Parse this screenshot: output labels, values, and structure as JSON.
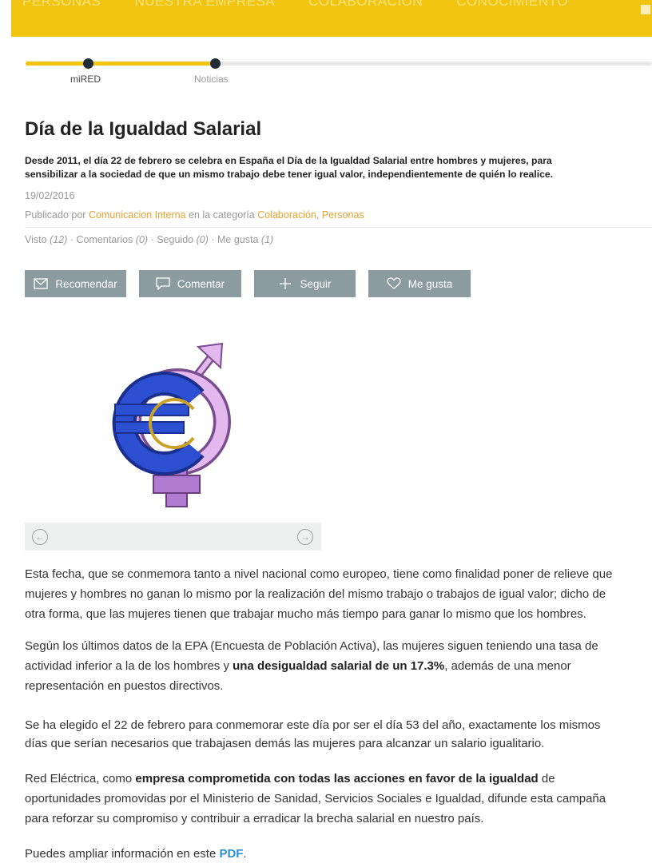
{
  "nav": {
    "items": [
      "PERSONAS",
      "NUESTRA EMPRESA",
      "COLABORACIÓN",
      "CONOCIMIENTO"
    ]
  },
  "breadcrumb_steps": [
    {
      "label": "miRED"
    },
    {
      "label": "Noticias"
    }
  ],
  "article": {
    "title": "Día de la Igualdad Salarial",
    "lead_line1": "Desde 2011, el día 22 de febrero se celebra en España el Día de la Igualdad Salarial entre hombres y mujeres, para",
    "lead_line2": "sensibilizar a la sociedad de que un mismo trabajo debe tener igual valor, independientemente de quién lo realice.",
    "date": "19/02/2016",
    "published_prefix": "Publicado por",
    "author": "Comunicacion Interna",
    "category_prefix": "en la categoría",
    "category_1": "Colaboración",
    "category_sep": ",",
    "category_2": "Personas",
    "stats": {
      "views_label": "Visto",
      "views": "(12)",
      "comments_label": "Comentarios",
      "comments": "(0)",
      "followed_label": "Seguido",
      "followed": "(0)",
      "likes_label": "Me gusta",
      "likes": "(1)",
      "separator": "·"
    },
    "buttons": {
      "recommend": "Recomendar",
      "comment": "Comentar",
      "follow": "Seguir",
      "like": "Me gusta"
    },
    "slider": {
      "prev_icon": "arrow-left-circle-icon",
      "next_icon": "arrow-right-circle-icon"
    },
    "paragraphs": {
      "p1_l1": "Esta fecha, que se conmemora tanto a nivel nacional como europeo, tiene como finalidad poner de relieve que",
      "p1_l2": "mujeres y hombres no ganan lo mismo por la realización del mismo trabajo o trabajos de igual valor; dicho de",
      "p1_l3": "otra forma, que las mujeres tienen que trabajar mucho más tiempo para ganar lo mismo que los hombres.",
      "p2_l1": "Según los últimos datos de la EPA (Encuesta de Población Activa), las mujeres siguen teniendo una tasa de",
      "p2_l2_a": "actividad inferior a la de los hombres y ",
      "p2_l2_b": "una desigualdad salarial de un 17.3%",
      "p2_l2_c": ", además de una menor",
      "p2_l3": "representación en puestos directivos.",
      "p3_l1": "Se ha elegido el 22 de febrero para conmemorar este día por ser el día 53 del año, exactamente los mismos",
      "p3_l2": "días que serían necesarios que trabajasen demás  las mujeres para alcanzar un salario igualitario.",
      "p4_l1_a": "Red Eléctrica, como ",
      "p4_l1_b": "empresa comprometida con todas las acciones en favor de la igualdad",
      "p4_l1_c": " de",
      "p4_l2": "oportunidades promovidas por el Ministerio de Sanidad, Servicios Sociales e Igualdad, difunde esta campaña",
      "p4_l3": "para reforzar su compromiso y contribuir a erradicar la brecha salarial en nuestro país.",
      "p5_a": "Puedes ampliar información en este ",
      "p5_link": "PDF",
      "p5_b": "."
    }
  },
  "colors": {
    "brand_yellow": "#f1c40f",
    "button_gray": "#8c9ba0",
    "link_orange": "#e6a230",
    "link_blue": "#2a8fd0"
  }
}
